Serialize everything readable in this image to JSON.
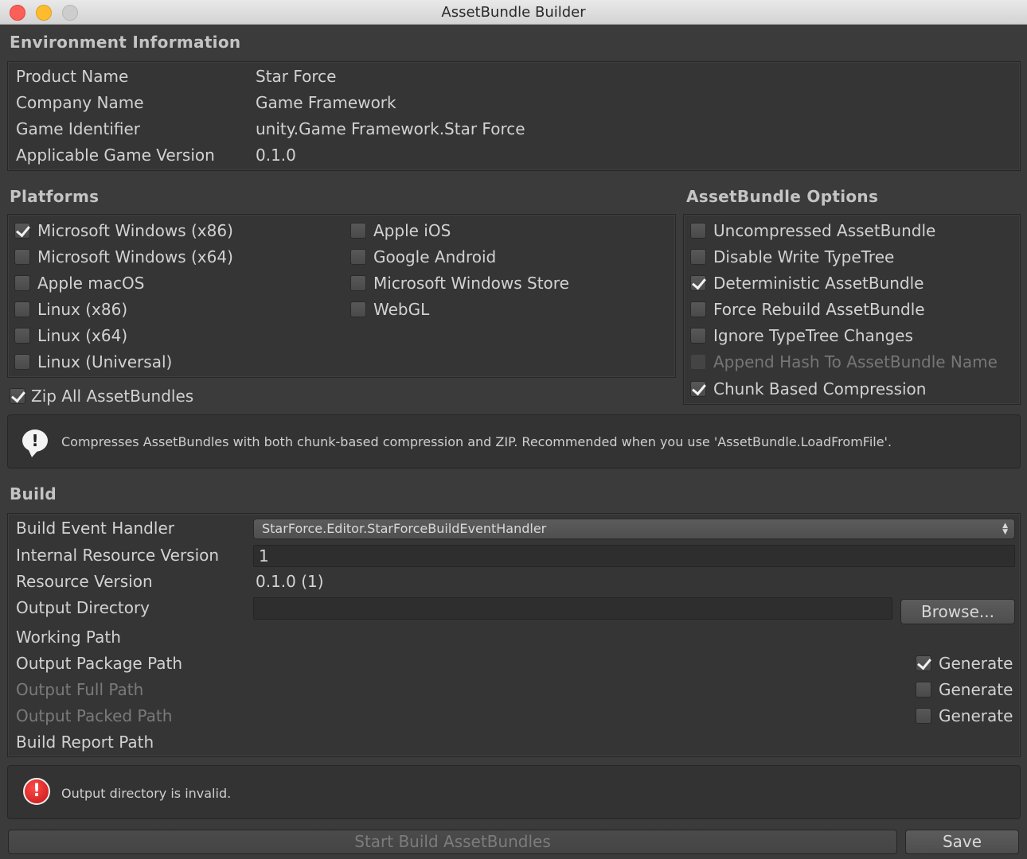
{
  "window": {
    "title": "AssetBundle Builder"
  },
  "environment": {
    "heading": "Environment Information",
    "rows": [
      {
        "label": "Product Name",
        "value": "Star Force"
      },
      {
        "label": "Company Name",
        "value": "Game Framework"
      },
      {
        "label": "Game Identifier",
        "value": "unity.Game Framework.Star Force"
      },
      {
        "label": "Applicable Game Version",
        "value": "0.1.0"
      }
    ]
  },
  "platforms": {
    "heading": "Platforms",
    "items": [
      {
        "label": "Microsoft Windows (x86)",
        "checked": true
      },
      {
        "label": "Microsoft Windows (x64)",
        "checked": false
      },
      {
        "label": "Apple macOS",
        "checked": false
      },
      {
        "label": "Linux (x86)",
        "checked": false
      },
      {
        "label": "Linux (x64)",
        "checked": false
      },
      {
        "label": "Linux (Universal)",
        "checked": false
      },
      {
        "label": "Apple iOS",
        "checked": false
      },
      {
        "label": "Google Android",
        "checked": false
      },
      {
        "label": "Microsoft Windows Store",
        "checked": false
      },
      {
        "label": "WebGL",
        "checked": false
      }
    ],
    "zip_all": {
      "label": "Zip All AssetBundles",
      "checked": true
    }
  },
  "options": {
    "heading": "AssetBundle Options",
    "items": [
      {
        "label": "Uncompressed AssetBundle",
        "checked": false,
        "enabled": true
      },
      {
        "label": "Disable Write TypeTree",
        "checked": false,
        "enabled": true
      },
      {
        "label": "Deterministic AssetBundle",
        "checked": true,
        "enabled": true
      },
      {
        "label": "Force Rebuild AssetBundle",
        "checked": false,
        "enabled": true
      },
      {
        "label": "Ignore TypeTree Changes",
        "checked": false,
        "enabled": true
      },
      {
        "label": "Append Hash To AssetBundle Name",
        "checked": false,
        "enabled": false
      },
      {
        "label": "Chunk Based Compression",
        "checked": true,
        "enabled": true
      }
    ]
  },
  "info_message": "Compresses AssetBundles with both chunk-based compression and ZIP. Recommended when you use 'AssetBundle.LoadFromFile'.",
  "build": {
    "heading": "Build",
    "event_handler_label": "Build Event Handler",
    "event_handler_value": "StarForce.Editor.StarForceBuildEventHandler",
    "internal_version_label": "Internal Resource Version",
    "internal_version_value": "1",
    "resource_version_label": "Resource Version",
    "resource_version_value": "0.1.0 (1)",
    "output_dir_label": "Output Directory",
    "output_dir_value": "",
    "browse_label": "Browse...",
    "working_path_label": "Working Path",
    "output_package_label": "Output Package Path",
    "output_full_label": "Output Full Path",
    "output_packed_label": "Output Packed Path",
    "build_report_label": "Build Report Path",
    "generate_label": "Generate",
    "generate_package_checked": true,
    "generate_full_checked": false,
    "generate_packed_checked": false
  },
  "error_message": "Output directory is invalid.",
  "footer": {
    "start_label": "Start Build AssetBundles",
    "save_label": "Save"
  }
}
